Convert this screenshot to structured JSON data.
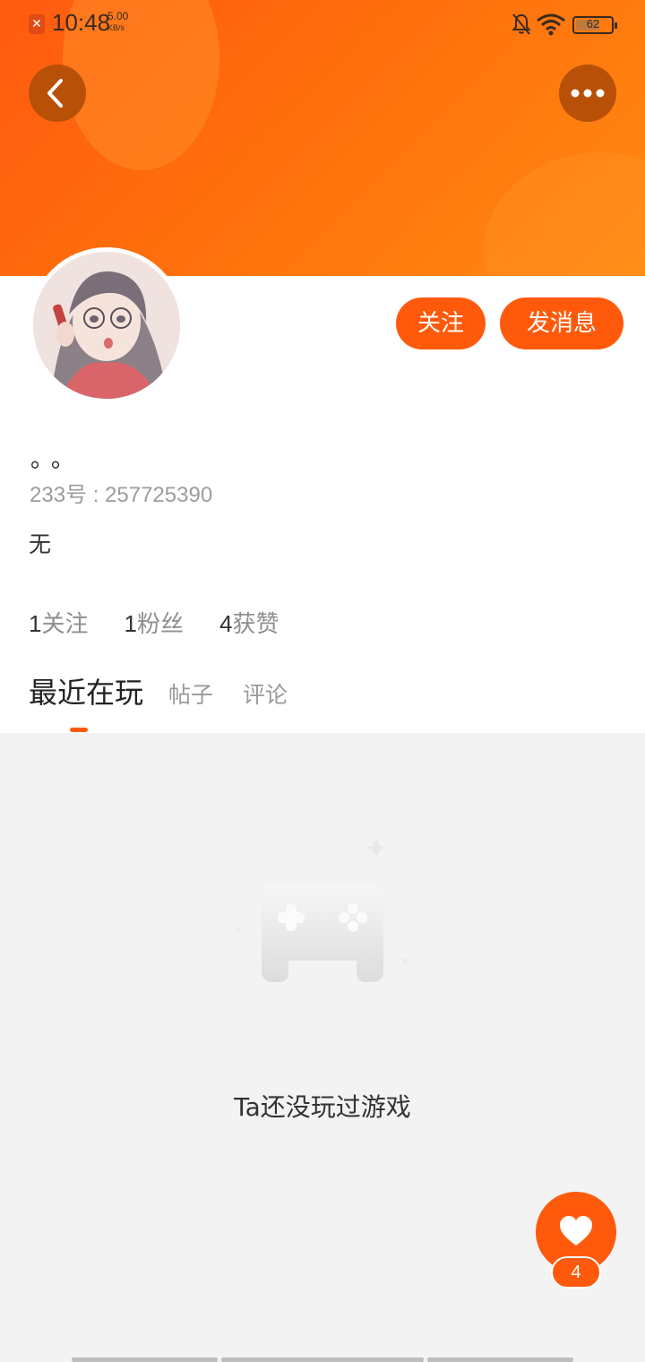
{
  "status_bar": {
    "time": "10:48",
    "speed_value": "5.00",
    "speed_unit": "KB/s",
    "battery": "62",
    "sim_icon": "sim-error-icon",
    "bell_icon": "bell-muted-icon",
    "wifi_icon": "wifi-icon"
  },
  "header": {
    "back_icon": "chevron-left-icon",
    "more_icon": "more-dots-icon"
  },
  "profile": {
    "nickname": "。。",
    "uid": "233号 : 257725390",
    "bio": "无",
    "follow_label": "关注",
    "message_label": "发消息"
  },
  "stats": [
    {
      "value": "1",
      "label": "关注"
    },
    {
      "value": "1",
      "label": "粉丝"
    },
    {
      "value": "4",
      "label": "获赞"
    }
  ],
  "tabs": [
    {
      "label": "最近在玩",
      "active": true
    },
    {
      "label": "帖子",
      "active": false
    },
    {
      "label": "评论",
      "active": false
    }
  ],
  "empty_state": {
    "icon": "gamepad-icon",
    "text": "Ta还没玩过游戏"
  },
  "like_fab": {
    "icon": "heart-icon",
    "count": "4"
  },
  "colors": {
    "accent": "#ff5a0c",
    "header_gradient_start": "#ff5a10",
    "header_gradient_end": "#ff8a12"
  }
}
